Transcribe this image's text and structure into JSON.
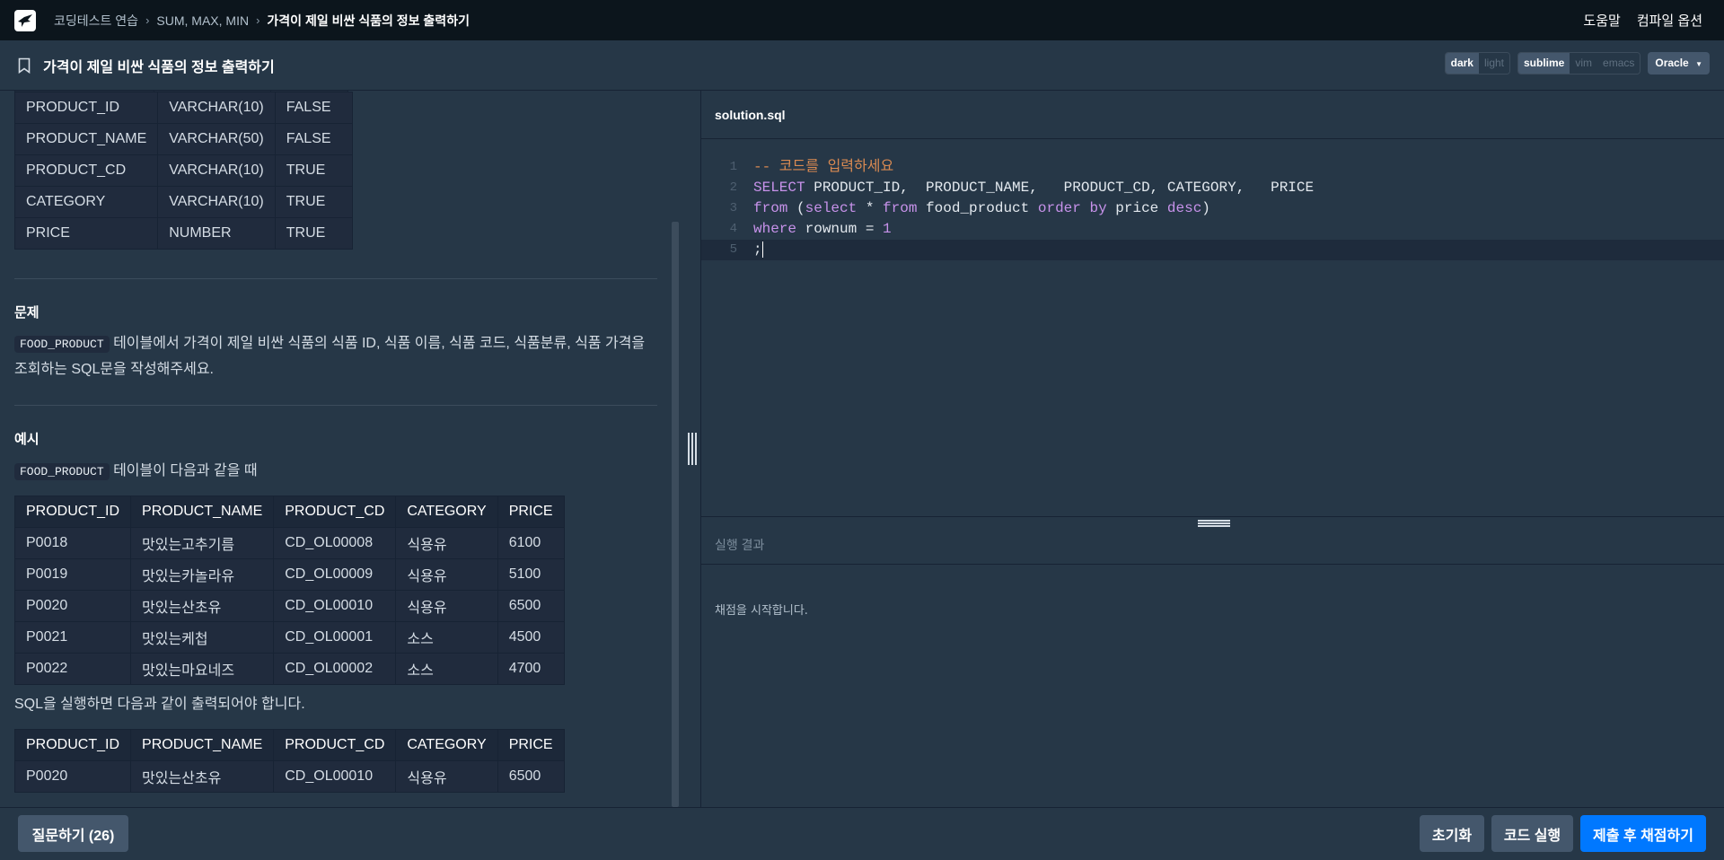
{
  "nav": {
    "breadcrumbs": [
      "코딩테스트 연습",
      "SUM, MAX, MIN",
      "가격이 제일 비싼 식품의 정보 출력하기"
    ],
    "help": "도움말",
    "compile_options": "컴파일 옵션"
  },
  "header": {
    "title": "가격이 제일 비싼 식품의 정보 출력하기",
    "theme": {
      "dark": "dark",
      "light": "light",
      "selected": "dark"
    },
    "keymap": {
      "sublime": "sublime",
      "vim": "vim",
      "emacs": "emacs",
      "selected": "sublime"
    },
    "language": "Oracle"
  },
  "schema": {
    "rows": [
      [
        "PRODUCT_ID",
        "VARCHAR(10)",
        "FALSE"
      ],
      [
        "PRODUCT_NAME",
        "VARCHAR(50)",
        "FALSE"
      ],
      [
        "PRODUCT_CD",
        "VARCHAR(10)",
        "TRUE"
      ],
      [
        "CATEGORY",
        "VARCHAR(10)",
        "TRUE"
      ],
      [
        "PRICE",
        "NUMBER",
        "TRUE"
      ]
    ]
  },
  "problem": {
    "title": "문제",
    "table_code": "FOOD_PRODUCT",
    "text1": "테이블에서 가격이 제일 비싼 식품의 식품 ID, 식품 이름, 식품 코드, 식품분류, 식품 가격을",
    "text2": "조회하는 SQL문을 작성해주세요."
  },
  "example": {
    "title": "예시",
    "table_code": "FOOD_PRODUCT",
    "intro": "테이블이 다음과 같을 때",
    "headers": [
      "PRODUCT_ID",
      "PRODUCT_NAME",
      "PRODUCT_CD",
      "CATEGORY",
      "PRICE"
    ],
    "rows": [
      [
        "P0018",
        "맛있는고추기름",
        "CD_OL00008",
        "식용유",
        "6100"
      ],
      [
        "P0019",
        "맛있는카놀라유",
        "CD_OL00009",
        "식용유",
        "5100"
      ],
      [
        "P0020",
        "맛있는산초유",
        "CD_OL00010",
        "식용유",
        "6500"
      ],
      [
        "P0021",
        "맛있는케첩",
        "CD_OL00001",
        "소스",
        "4500"
      ],
      [
        "P0022",
        "맛있는마요네즈",
        "CD_OL00002",
        "소스",
        "4700"
      ]
    ],
    "result_intro": "SQL을 실행하면 다음과 같이 출력되어야 합니다.",
    "result_headers": [
      "PRODUCT_ID",
      "PRODUCT_NAME",
      "PRODUCT_CD",
      "CATEGORY",
      "PRICE"
    ],
    "result_rows": [
      [
        "P0020",
        "맛있는산초유",
        "CD_OL00010",
        "식용유",
        "6500"
      ]
    ]
  },
  "editor": {
    "filename": "solution.sql",
    "line_numbers": [
      "1",
      "2",
      "3",
      "4",
      "5"
    ],
    "line1": "-- 코드를 입력하세요",
    "line2_kw": "SELECT",
    "line2_rest": " PRODUCT_ID,  PRODUCT_NAME,   PRODUCT_CD, CATEGORY,   PRICE",
    "line3_from": "from",
    "line3_paren": " (",
    "line3_select": "select",
    "line3_star": " * ",
    "line3_from2": "from",
    "line3_table": " food_product ",
    "line3_order": "order by",
    "line3_price": " price ",
    "line3_desc": "desc",
    "line3_close": ")",
    "line4_where": "where",
    "line4_rest": " rownum = ",
    "line4_num": "1",
    "line5": ";"
  },
  "result": {
    "label": "실행 결과",
    "message": "채점을 시작합니다."
  },
  "footer": {
    "ask": "질문하기 (26)",
    "reset": "초기화",
    "run": "코드 실행",
    "submit": "제출 후 채점하기"
  }
}
